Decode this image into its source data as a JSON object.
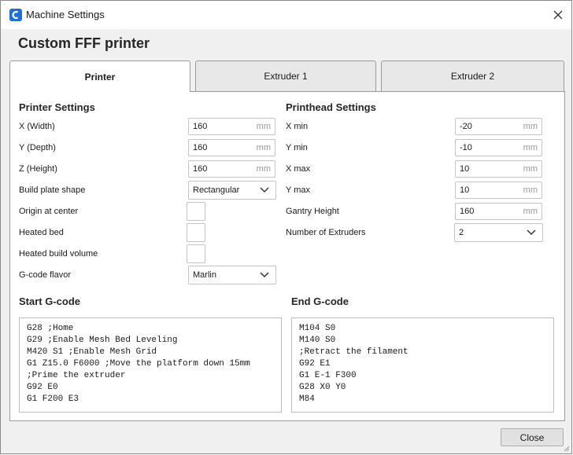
{
  "window": {
    "title": "Machine Settings"
  },
  "heading": "Custom FFF printer",
  "tabs": [
    {
      "label": "Printer",
      "active": true
    },
    {
      "label": "Extruder 1",
      "active": false
    },
    {
      "label": "Extruder 2",
      "active": false
    }
  ],
  "printer_settings": {
    "title": "Printer Settings",
    "x_width": {
      "label": "X (Width)",
      "value": "160",
      "unit": "mm"
    },
    "y_depth": {
      "label": "Y (Depth)",
      "value": "160",
      "unit": "mm"
    },
    "z_height": {
      "label": "Z (Height)",
      "value": "160",
      "unit": "mm"
    },
    "build_plate_shape": {
      "label": "Build plate shape",
      "value": "Rectangular"
    },
    "origin_at_center": {
      "label": "Origin at center",
      "checked": false
    },
    "heated_bed": {
      "label": "Heated bed",
      "checked": false
    },
    "heated_build_volume": {
      "label": "Heated build volume",
      "checked": false
    },
    "gcode_flavor": {
      "label": "G-code flavor",
      "value": "Marlin"
    }
  },
  "printhead_settings": {
    "title": "Printhead Settings",
    "x_min": {
      "label": "X min",
      "value": "-20",
      "unit": "mm"
    },
    "y_min": {
      "label": "Y min",
      "value": "-10",
      "unit": "mm"
    },
    "x_max": {
      "label": "X max",
      "value": "10",
      "unit": "mm"
    },
    "y_max": {
      "label": "Y max",
      "value": "10",
      "unit": "mm"
    },
    "gantry_height": {
      "label": "Gantry Height",
      "value": "160",
      "unit": "mm"
    },
    "number_of_extruders": {
      "label": "Number of Extruders",
      "value": "2"
    }
  },
  "start_gcode": {
    "title": "Start G-code",
    "lines": [
      "G28 ;Home",
      "G29 ;Enable Mesh Bed Leveling",
      "M420 S1 ;Enable Mesh Grid",
      "G1 Z15.0 F6000 ;Move the platform down 15mm",
      ";Prime the extruder",
      "G92 E0",
      "G1 F200 E3"
    ]
  },
  "end_gcode": {
    "title": "End G-code",
    "lines": [
      "M104 S0",
      "M140 S0",
      ";Retract the filament",
      "G92 E1",
      "G1 E-1 F300",
      "G28 X0 Y0",
      "M84"
    ]
  },
  "buttons": {
    "close": "Close"
  },
  "colors": {
    "brand": "#1e6fd9"
  }
}
